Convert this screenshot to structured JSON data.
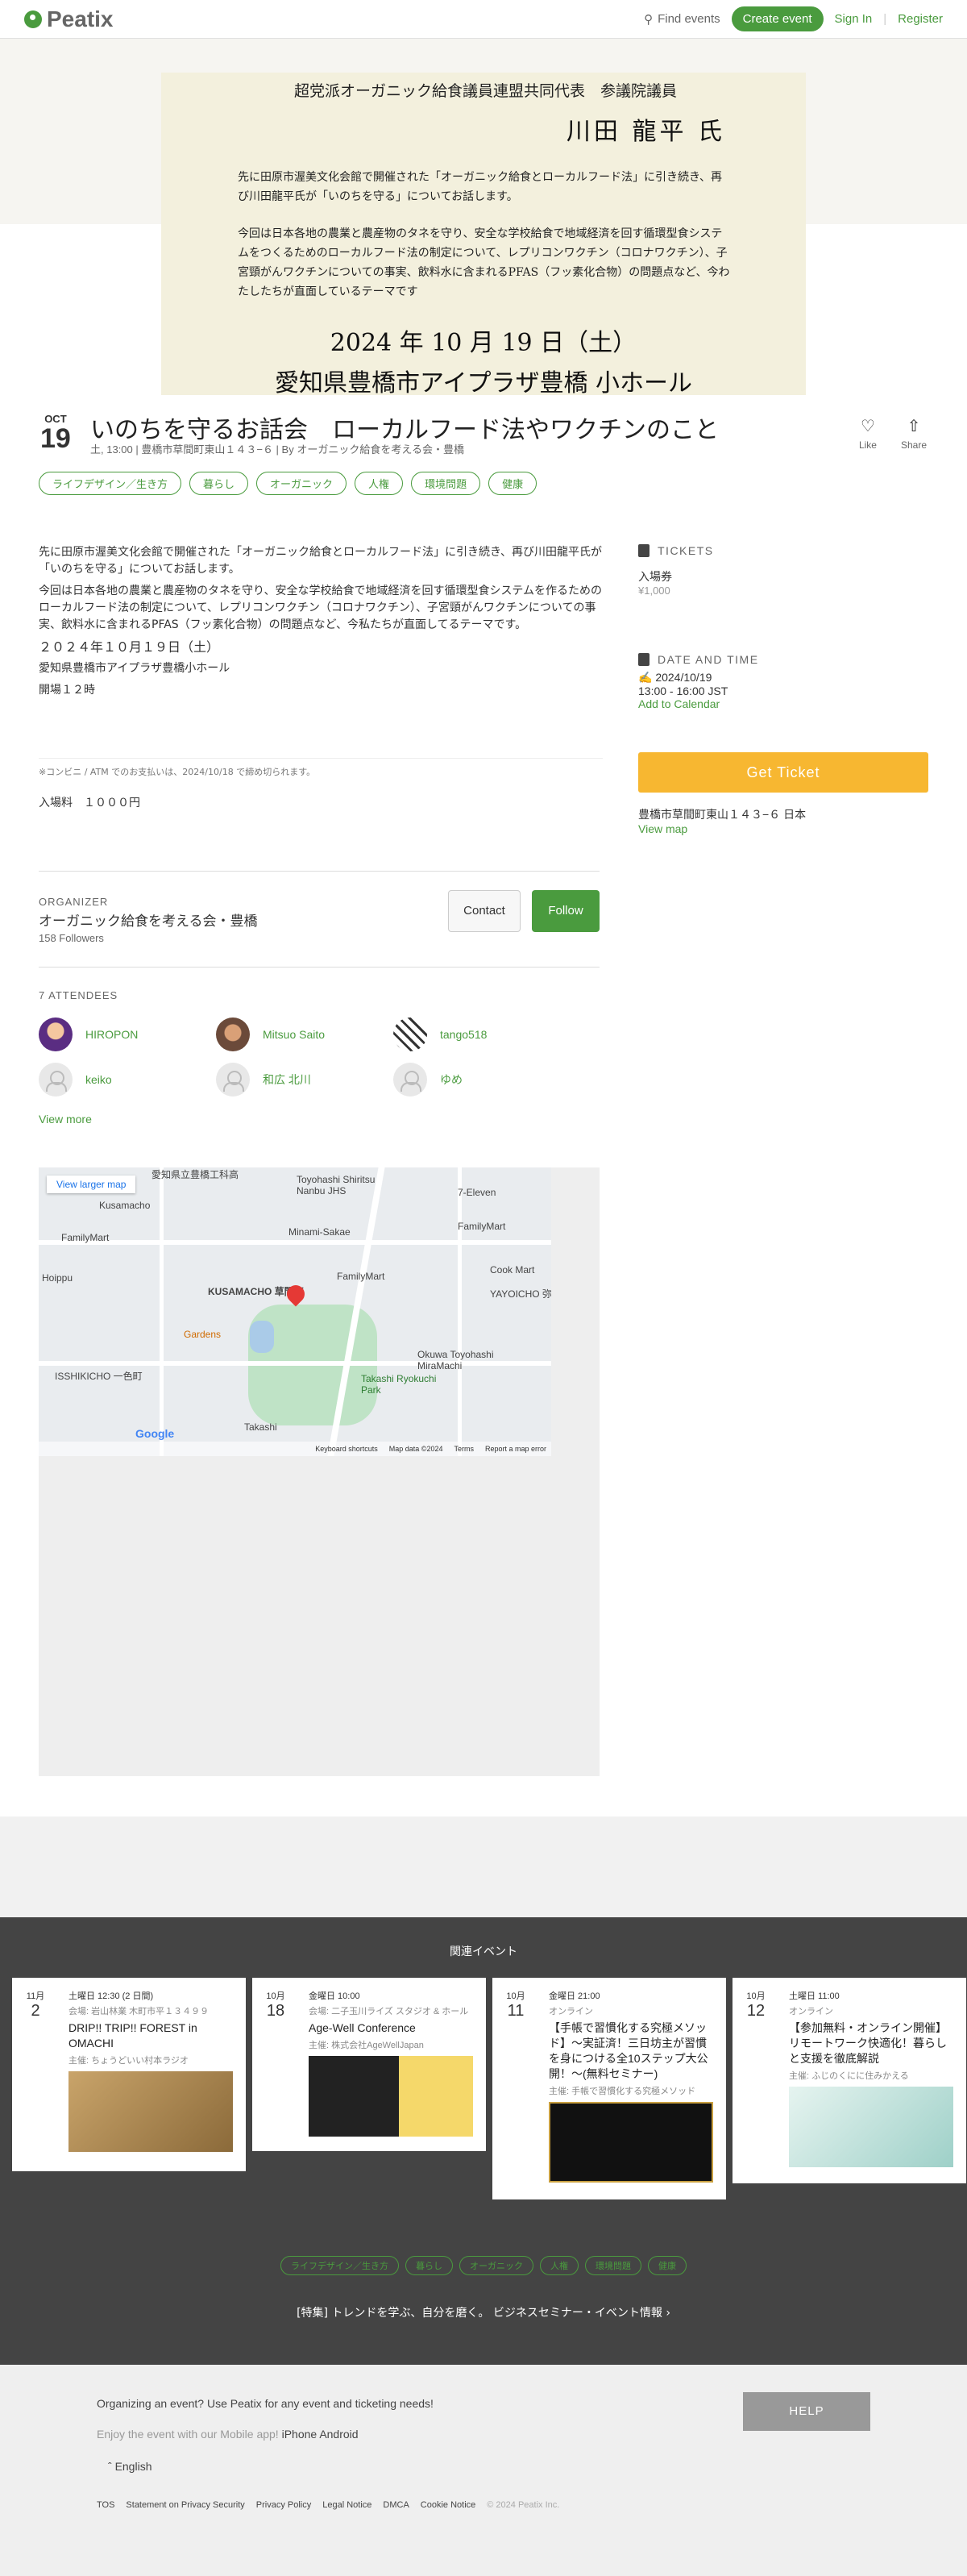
{
  "header": {
    "logo": "Peatix",
    "find_events": "Find events",
    "create_event": "Create event",
    "sign_in": "Sign In",
    "separator": "|",
    "register": "Register"
  },
  "hero": {
    "line1": "超党派オーガニック給食議員連盟共同代表　参議院議員",
    "line2": "川田 龍平 氏",
    "p1": "先に田原市渥美文化会館で開催された「オーガニック給食とローカルフード法」に引き続き、再び川田龍平氏が「いのちを守る」についてお話します。",
    "p2": "今回は日本各地の農業と農産物のタネを守り、安全な学校給食で地域経済を回す循環型食システムをつくるためのローカルフード法の制定について、レプリコンワクチン（コロナワクチン）、子宮頸がんワクチンについての事実、飲料水に含まれるPFAS（フッ素化合物）の問題点など、今わたしたちが直面しているテーマです",
    "date": "2024 年 10 月 19 日（土）",
    "venue": "愛知県豊橋市アイプラザ豊橋 小ホール"
  },
  "event": {
    "month": "OCT",
    "day": "19",
    "title": "いのちを守るお話会　ローカルフード法やワクチンのこと",
    "meta": "土, 13:00 | 豊橋市草間町東山１４３−６ | By オーガニック給食を考える会・豊橋",
    "like": "Like",
    "share": "Share",
    "tags": [
      "ライフデザイン／生き方",
      "暮らし",
      "オーガニック",
      "人権",
      "環境問題",
      "健康"
    ]
  },
  "description": {
    "p1": "先に田原市渥美文化会館で開催された「オーガニック給食とローカルフード法」に引き続き、再び川田龍平氏が「いのちを守る」についてお話します。",
    "p2": "今回は日本各地の農業と農産物のタネを守り、安全な学校給食で地域経済を回す循環型食システムを作るためのローカルフード法の制定について、レプリコンワクチン（コロナワクチン）、子宮頸がんワクチンについての事実、飲料水に含まれるPFAS（フッ素化合物）の問題点など、今私たちが直面してるテーマです。",
    "p3": "２０２４年１０月１９日（土）",
    "p4": "愛知県豊橋市アイプラザ豊橋小ホール",
    "p5": "開場１２時",
    "p6": "入場料　１０００円",
    "notice": "※コンビニ / ATM でのお支払いは、2024/10/18 で締め切られます。"
  },
  "sidebar": {
    "tickets_heading": "TICKETS",
    "ticket_name": "入場券",
    "ticket_price": "¥1,000",
    "datetime_heading": "DATE AND TIME",
    "date": "2024/10/19",
    "time": "13:00 - 16:00 JST",
    "add_calendar": "Add to Calendar",
    "get_ticket": "Get Ticket",
    "address": "豊橋市草間町東山１４３−６ 日本",
    "view_map": "View map"
  },
  "organizer": {
    "label": "ORGANIZER",
    "name": "オーガニック給食を考える会・豊橋",
    "followers": "158 Followers",
    "contact": "Contact",
    "follow": "Follow"
  },
  "attendees": {
    "label": "7 ATTENDEES",
    "list": [
      "HIROPON",
      "Mitsuo Saito",
      "tango518",
      "keiko",
      "和広 北川",
      "ゆめ"
    ],
    "view_more": "View more"
  },
  "map": {
    "view_larger": "View larger map",
    "labels": [
      "愛知県立豊橋工科高",
      "Toyohashi Shiritsu Nanbu JHS",
      "7-Eleven",
      "Kusamacho",
      "FamilyMart",
      "Minami-Sakae",
      "FamilyMart",
      "Hoippu",
      "KUSAMACHO 草間町",
      "FamilyMart",
      "Cook Mart",
      "YAYOICHO 弥生町",
      "Gardens",
      "Okuwa Toyohashi MiraMachi",
      "ISSHIKICHO 一色町",
      "Takashi Ryokuchi Park",
      "Takashi"
    ],
    "google": "Google",
    "shortcuts": "Keyboard shortcuts",
    "map_data": "Map data ©2024",
    "terms": "Terms",
    "report": "Report a map error"
  },
  "related": {
    "title": "関連イベント",
    "cards": [
      {
        "month": "11月",
        "day": "2",
        "when": "土曜日 12:30 (2 日間)",
        "place": "会場: 岩山林業 木町市平１３４９９",
        "title": "DRIP!! TRIP!! FOREST in OMACHI",
        "org": "主催: ちょうどいい村本ラジオ"
      },
      {
        "month": "10月",
        "day": "18",
        "when": "金曜日 10:00",
        "place": "会場: 二子玉川ライズ スタジオ & ホール",
        "title": "Age-Well Conference",
        "org": "主催: 株式会社AgeWellJapan"
      },
      {
        "month": "10月",
        "day": "11",
        "when": "金曜日 21:00",
        "place": "オンライン",
        "title": "【手帳で習慣化する究極メソッド】〜実証済！三日坊主が習慣を身につける全10ステップ大公開！〜(無料セミナー)",
        "org": "主催: 手帳で習慣化する究極メソッド"
      },
      {
        "month": "10月",
        "day": "12",
        "when": "土曜日 11:00",
        "place": "オンライン",
        "title": "【参加無料・オンライン開催】リモートワーク快適化！暮らしと支援を徹底解説",
        "org": "主催: ふじのくにに住みかえる"
      }
    ],
    "tags": [
      "ライフデザイン／生き方",
      "暮らし",
      "オーガニック",
      "人権",
      "環境問題",
      "健康"
    ],
    "link": "[特集] トレンドを学ぶ、自分を磨く。 ビジネスセミナー・イベント情報 ›"
  },
  "footer": {
    "organizing": "Organizing an event? Use Peatix for any event and ticketing needs!",
    "app_text": "Enjoy the event with our Mobile app!",
    "iphone": "iPhone",
    "android": "Android",
    "help": "HELP",
    "language": "English",
    "links": [
      "TOS",
      "Statement on Privacy Security",
      "Privacy Policy",
      "Legal Notice",
      "DMCA",
      "Cookie Notice"
    ],
    "copyright": "© 2024 Peatix Inc."
  },
  "colors": {
    "brand": "#4a9b3e",
    "ticket": "#f7b731",
    "related_bg": "#444444"
  }
}
